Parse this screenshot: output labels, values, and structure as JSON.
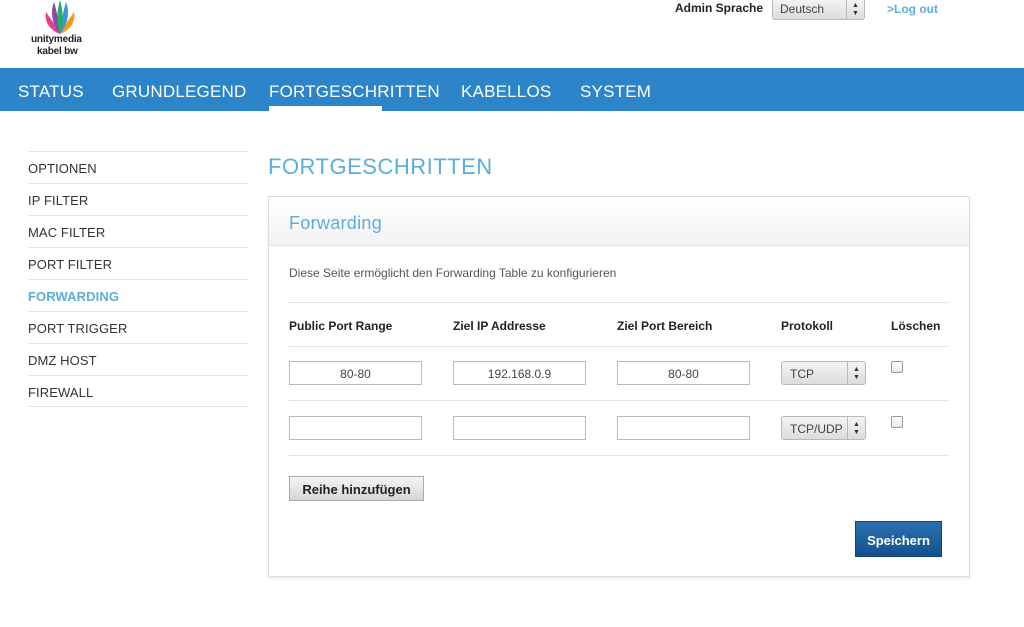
{
  "header": {
    "logo_line1": "unitymedia",
    "logo_line2": "kabel bw",
    "lang_label": "Admin Sprache",
    "lang_value": "Deutsch",
    "logout": ">Log out"
  },
  "nav": {
    "items": [
      "STATUS",
      "GRUNDLEGEND",
      "FORTGESCHRITTEN",
      "KABELLOS",
      "SYSTEM"
    ],
    "active": "FORTGESCHRITTEN"
  },
  "sidebar": {
    "items": [
      "OPTIONEN",
      "IP FILTER",
      "MAC FILTER",
      "PORT FILTER",
      "FORWARDING",
      "PORT TRIGGER",
      "DMZ HOST",
      "FIREWALL"
    ],
    "active": "FORWARDING"
  },
  "main": {
    "title": "FORTGESCHRITTEN",
    "panel_title": "Forwarding",
    "description": "Diese Seite ermöglicht den Forwarding Table zu konfigurieren",
    "columns": [
      "Public Port Range",
      "Ziel IP Addresse",
      "Ziel Port Bereich",
      "Protokoll",
      "Löschen"
    ],
    "rows": [
      {
        "public_port": "80-80",
        "ip": "192.168.0.9",
        "port_range": "80-80",
        "protocol": "TCP",
        "delete": false
      },
      {
        "public_port": "",
        "ip": "",
        "port_range": "",
        "protocol": "TCP/UDP",
        "delete": false
      }
    ],
    "add_row_label": "Reihe hinzufügen",
    "save_label": "Speichern"
  },
  "colors": {
    "nav_bg": "#2c84c9",
    "accent": "#5aaede",
    "save_bg": "#1a5e9e"
  }
}
